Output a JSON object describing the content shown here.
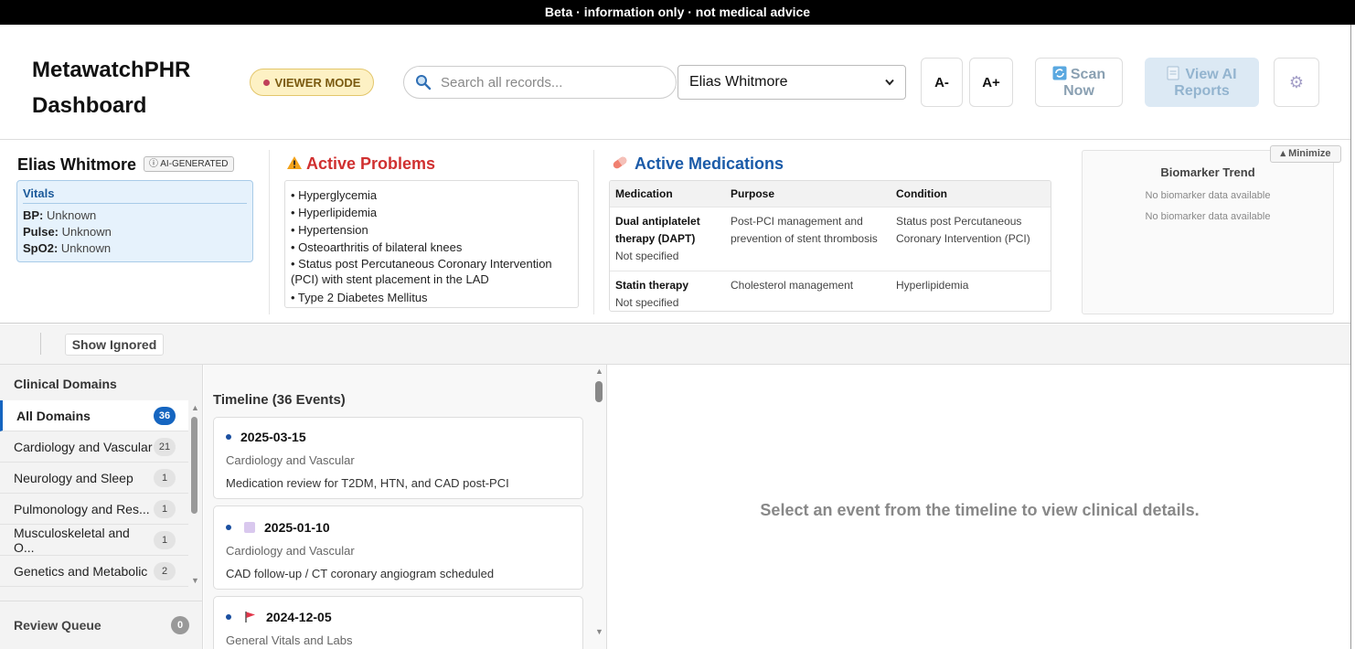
{
  "banner": "Beta · information only · not medical advice",
  "header": {
    "title": "MetawatchPHR Dashboard",
    "viewer_mode": "VIEWER MODE",
    "search_placeholder": "Search all records...",
    "patient": "Elias Whitmore",
    "font_decrease": "A-",
    "font_increase": "A+",
    "scan_label": "Scan Now",
    "ai_reports_label": "View AI Reports"
  },
  "summary": {
    "patient_name": "Elias Whitmore",
    "ai_badge": "AI-GENERATED",
    "vitals": {
      "title": "Vitals",
      "items": [
        {
          "label": "BP:",
          "value": "Unknown"
        },
        {
          "label": "Pulse:",
          "value": "Unknown"
        },
        {
          "label": "SpO2:",
          "value": "Unknown"
        }
      ]
    },
    "problems": {
      "title": "Active Problems",
      "items": [
        "• Hyperglycemia",
        "• Hyperlipidemia",
        "• Hypertension",
        "• Osteoarthritis of bilateral knees",
        "• Status post Percutaneous Coronary Intervention (PCI) with stent placement in the LAD",
        "• Type 2 Diabetes Mellitus"
      ]
    },
    "medications": {
      "title": "Active Medications",
      "columns": [
        "Medication",
        "Purpose",
        "Condition"
      ],
      "rows": [
        {
          "name": "Dual antiplatelet therapy (DAPT)",
          "dose": "Not specified",
          "purpose": "Post-PCI management and prevention of stent thrombosis",
          "condition": "Status post Percutaneous Coronary Intervention (PCI)"
        },
        {
          "name": "Statin therapy",
          "dose": "Not specified",
          "purpose": "Cholesterol management",
          "condition": "Hyperlipidemia"
        }
      ]
    },
    "biomarker": {
      "minimize": "Minimize",
      "title": "Biomarker Trend",
      "empty1": "No biomarker data available",
      "empty2": "No biomarker data available"
    }
  },
  "toolbar": {
    "show_ignored": "Show Ignored"
  },
  "domains": {
    "title": "Clinical Domains",
    "items": [
      {
        "label": "All Domains",
        "count": "36"
      },
      {
        "label": "Cardiology and Vascular",
        "count": "21"
      },
      {
        "label": "Neurology and Sleep",
        "count": "1"
      },
      {
        "label": "Pulmonology and Res...",
        "count": "1"
      },
      {
        "label": "Musculoskeletal and O...",
        "count": "1"
      },
      {
        "label": "Genetics and Metabolic",
        "count": "2"
      }
    ],
    "review_queue": "Review Queue",
    "review_count": "0"
  },
  "timeline": {
    "title": "Timeline (36 Events)",
    "events": [
      {
        "date": "2025-03-15",
        "category": "Cardiology and Vascular",
        "summary": "Medication review for T2DM, HTN, and CAD post-PCI",
        "icon": "none"
      },
      {
        "date": "2025-01-10",
        "category": "Cardiology and Vascular",
        "summary": "CAD follow-up / CT coronary angiogram scheduled",
        "icon": "lilac-square-icon"
      },
      {
        "date": "2024-12-05",
        "category": "General Vitals and Labs",
        "summary": "",
        "icon": "red-flag-icon"
      }
    ]
  },
  "detail": {
    "empty": "Select an event from the timeline to view clinical details."
  },
  "colors": {
    "accent": "#1565c0",
    "problems": "#d03030",
    "medications": "#1a5aa8"
  }
}
